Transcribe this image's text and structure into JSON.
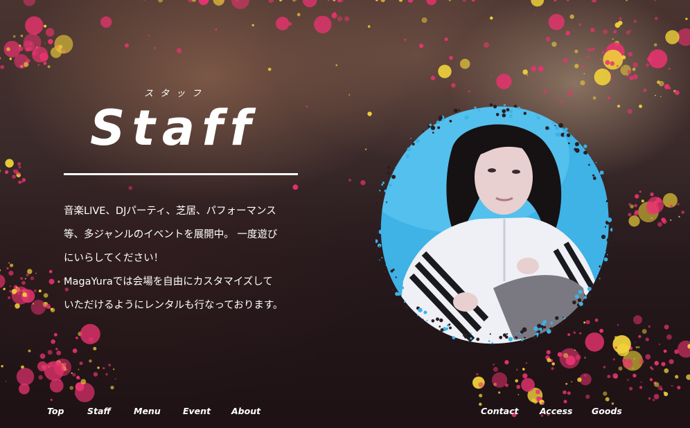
{
  "hero": {
    "kana": "スタッフ",
    "title": "Staff",
    "body": [
      "音楽LIVE、DJパーティ、芝居、パフォーマンス",
      "等、多ジャンルのイベントを展開中。 一度遊び",
      "にいらしてください！",
      "MagaYuraでは会場を自由にカスタマイズして",
      "いただけるようにレンタルも行なっております。"
    ]
  },
  "nav_left": [
    "Top",
    "Staff",
    "Menu",
    "Event",
    "About"
  ],
  "nav_right": [
    "Contact",
    "Access",
    "Goods"
  ],
  "colors": {
    "splatter_pink": "#e8336f",
    "splatter_yellow": "#f0d23a",
    "photo_bg": "#3fb2e6"
  }
}
